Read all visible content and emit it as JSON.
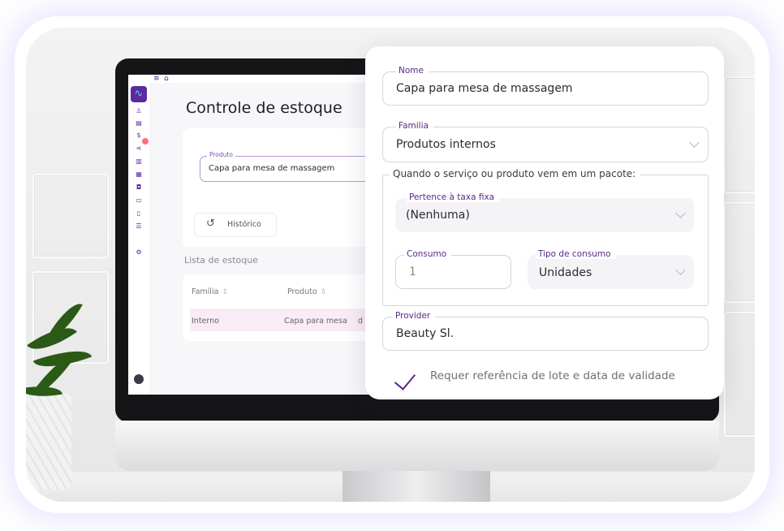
{
  "app": {
    "page_title": "Controle de estoque",
    "product_field": {
      "label": "Produto",
      "value": "Capa para mesa de massagem"
    },
    "history_button": "Histórico",
    "stock_list_title": "Lista de estoque",
    "table": {
      "headers": [
        "Família",
        "Produto"
      ],
      "rows": [
        {
          "familia": "Interno",
          "produto": "Capa para mesa",
          "extra": "d"
        }
      ]
    }
  },
  "form": {
    "nome": {
      "label": "Nome",
      "value": "Capa para mesa de massagem"
    },
    "familia": {
      "label": "Familia",
      "value": "Produtos internos"
    },
    "package_group_label": "Quando o serviço ou produto vem em um pacote:",
    "taxa_fixa": {
      "label": "Pertence à taxa fixa",
      "value": "(Nenhuma)"
    },
    "consumo": {
      "label": "Consumo",
      "value": "1"
    },
    "tipo_consumo": {
      "label": "Tipo de consumo",
      "value": "Unidades"
    },
    "provider": {
      "label": "Provider",
      "value": "Beauty Sl."
    },
    "lote_checkbox": {
      "label": "Requer referência de lote e data de validade",
      "checked": true
    }
  },
  "colors": {
    "accent": "#5a2a8a",
    "logo_bg": "#5b2aa0",
    "logo_wave": "#49d7e6",
    "row_highlight": "#f9ecf6",
    "badge": "#ff6f7d"
  },
  "icons": {
    "topbar": [
      "menu-icon",
      "home-icon"
    ],
    "sidebar": [
      "logo-icon",
      "user-icon",
      "clipboard-icon",
      "dollar-icon",
      "share-icon",
      "chart-icon",
      "calendar-icon",
      "bag-icon",
      "document-icon",
      "file-icon",
      "list-icon",
      "settings-icon",
      "account-icon"
    ]
  }
}
